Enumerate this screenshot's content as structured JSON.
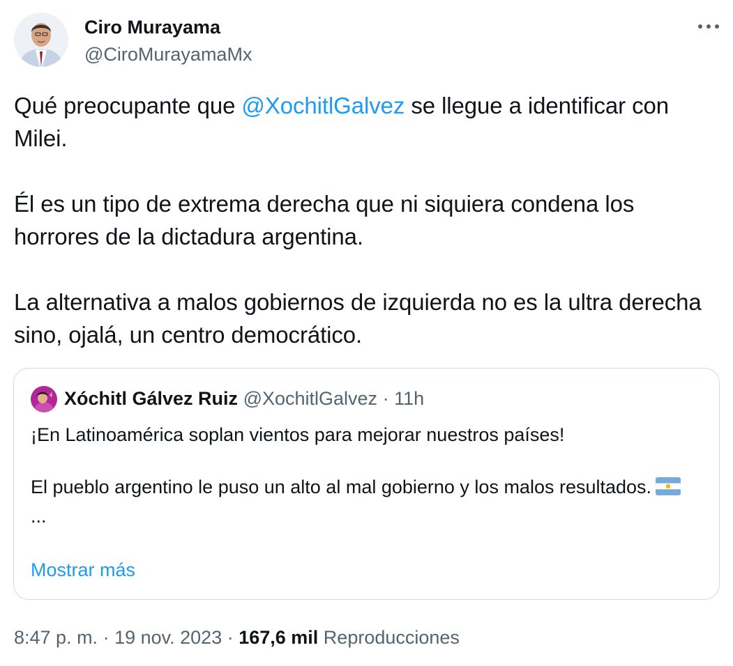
{
  "author": {
    "name": "Ciro Murayama",
    "handle": "@CiroMurayamaMx"
  },
  "tweet": {
    "p1_before": "Qué preocupante que ",
    "p1_mention": "@XochitlGalvez",
    "p1_after": " se llegue a identificar con Milei.",
    "p2": "Él es un tipo de extrema derecha que ni siquiera condena los horrores de la dictadura argentina.",
    "p3": "La alternativa a malos gobiernos de izquierda no es la ultra derecha sino, ojalá, un centro democrático."
  },
  "quoted": {
    "name": "Xóchitl Gálvez Ruiz",
    "handle": "@XochitlGalvez",
    "separator": "·",
    "time": "11h",
    "line1": "¡En Latinoamérica soplan vientos para mejorar nuestros países!",
    "line2": "El pueblo argentino le puso un alto al mal gobierno y los malos resultados.",
    "ellipsis": "...",
    "show_more": "Mostrar más"
  },
  "meta": {
    "time": "8:47 p. m.",
    "sep1": " · ",
    "date": "19 nov. 2023",
    "sep2": " · ",
    "views": "167,6 mil",
    "views_label": " Reproducciones"
  },
  "icons": {
    "more": "more-horizontal-icon",
    "flag": "argentina-flag-icon"
  },
  "colors": {
    "link": "#1d9bf0",
    "secondary": "#536471",
    "text": "#0f1419",
    "border": "#cfd9de"
  }
}
